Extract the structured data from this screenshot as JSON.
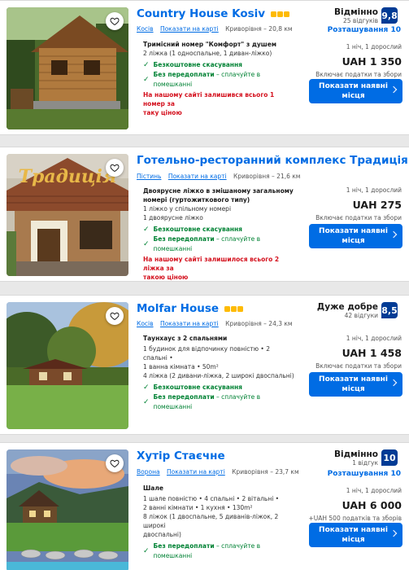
{
  "listings": [
    {
      "title": "Country House Kosiv",
      "stars": 3,
      "location": {
        "town": "Косів",
        "map_link": "Показати на карті",
        "distance": "Криворівня – 20,8 км"
      },
      "rating": {
        "word": "Відмінно",
        "count": "25 відгуків",
        "score": "9,8"
      },
      "location_score": "Розташування 10",
      "room": {
        "title": "Тримісний номер \"Комфорт\" з душем",
        "lines": [
          "2 ліжка (1 односпальне, 1 диван-ліжко)"
        ],
        "perks": [
          {
            "label": "Безкоштовне скасування",
            "suffix": ""
          },
          {
            "label": "Без передоплати",
            "suffix": " – сплачуйте в помешканні"
          }
        ],
        "scarcity": [
          "На нашому сайті залишився всього 1 номер за",
          "таку ціною"
        ]
      },
      "price": {
        "nights": "1 ніч, 1 дорослий",
        "amount": "UAH 1 350",
        "taxes": "Включає податки та збори"
      },
      "cta": "Показати наявні місця"
    },
    {
      "title": "Готельно-ресторанний комплекс Традиція",
      "stars": 0,
      "photo_sign": "Традиція",
      "location": {
        "town": "Пістинь",
        "map_link": "Показати на карті",
        "distance": "Криворівня – 21,6 км"
      },
      "rating": null,
      "location_score": "",
      "room": {
        "title": "Двоярусне ліжко в змішаному загальному номері (гуртожиткового типу)",
        "lines": [
          "1 ліжко у спільному номері",
          "1 двоярусне ліжко"
        ],
        "perks": [
          {
            "label": "Безкоштовне скасування",
            "suffix": ""
          },
          {
            "label": "Без передоплати",
            "suffix": " – сплачуйте в помешканні"
          }
        ],
        "scarcity": [
          "На нашому сайті залишилося всього 2 ліжка за",
          "такою ціною"
        ]
      },
      "price": {
        "nights": "1 ніч, 1 дорослий",
        "amount": "UAH 275",
        "taxes": "Включає податки та збори"
      },
      "cta": "Показати наявні місця"
    },
    {
      "title": "Molfar House",
      "stars": 3,
      "location": {
        "town": "Косів",
        "map_link": "Показати на карті",
        "distance": "Криворівня – 24,3 км"
      },
      "rating": {
        "word": "Дуже добре",
        "count": "42 відгуки",
        "score": "8,5"
      },
      "location_score": "",
      "room": {
        "title": "Таунхаус з 2 спальнями",
        "lines": [
          "1 будинок для відпочинку повністю • 2 спальні •",
          "1 ванна кімната • 50m²",
          "4 ліжка (2 дивани-ліжка, 2 широкі двоспальні)"
        ],
        "perks": [
          {
            "label": "Безкоштовне скасування",
            "suffix": ""
          },
          {
            "label": "Без передоплати",
            "suffix": " – сплачуйте в помешканні"
          }
        ],
        "scarcity": []
      },
      "price": {
        "nights": "1 ніч, 1 дорослий",
        "amount": "UAH 1 458",
        "taxes": "Включає податки та збори"
      },
      "cta": "Показати наявні місця"
    },
    {
      "title": "Хутір Стаєчне",
      "stars": 0,
      "location": {
        "town": "Ворона",
        "map_link": "Показати на карті",
        "distance": "Криворівня – 23,7 км"
      },
      "rating": {
        "word": "Відмінно",
        "count": "1 відгук",
        "score": "10"
      },
      "location_score": "Розташування 10",
      "room": {
        "title": "Шале",
        "lines": [
          "1 шале повністю • 4 спальні • 2 вітальні •",
          "2 ванні кімнати • 1 кухня • 130m²",
          "8 ліжок (1 двоспальне, 5 диванів-ліжок, 2 широкі",
          "двоспальні)"
        ],
        "perks": [
          {
            "label": "Без передоплати",
            "suffix": " – сплачуйте в помешканні"
          }
        ],
        "scarcity": []
      },
      "price": {
        "nights": "1 ніч, 1 дорослий",
        "amount": "UAH 6 000",
        "taxes": "+UAH 500 податків та зборів"
      },
      "cta": "Показати наявні місця"
    }
  ],
  "icons": {
    "favorite": "heart-icon",
    "perk": "check-icon",
    "cta": "chevron-right-icon"
  },
  "colors": {
    "link": "#006ce4",
    "score_bg": "#003b95",
    "perk": "#008234",
    "scarcity": "#d4111e",
    "stars": "#febb02"
  }
}
